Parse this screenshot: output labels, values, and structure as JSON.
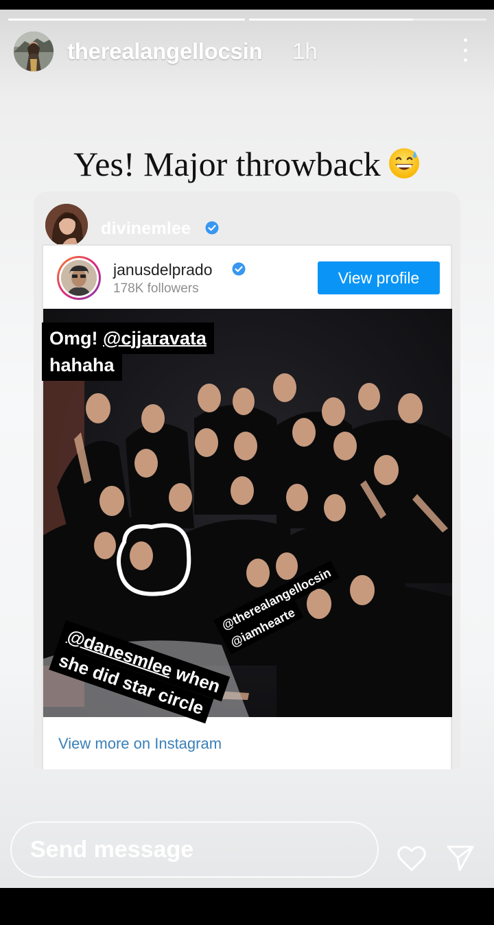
{
  "story": {
    "progress": [
      1.0,
      0.69
    ],
    "author": {
      "username": "therealangellocsin",
      "time": "1h",
      "avatar_icon": "profile-photo"
    },
    "more_icon": "more-vertical-icon",
    "caption": "Yes! Major throwback",
    "caption_emoji": "grinning-sweat-emoji"
  },
  "shared_post": {
    "sharer": {
      "username": "divinemlee",
      "verified": true
    },
    "embed": {
      "username": "janusdelprado",
      "verified": true,
      "followers": "178K followers",
      "view_profile_label": "View profile",
      "view_more_label": "View more on Instagram"
    },
    "stickers": {
      "top_line1_prefix": "Omg! ",
      "top_line1_mention": "@cjjaravata",
      "top_line2": "hahaha",
      "bottom_line1_mention": "@danesmlee",
      "bottom_line1_suffix": " when",
      "bottom_line2": "she did star circle",
      "tag1": "@therealangellocsin",
      "tag2": "@iamhearte"
    }
  },
  "reply_bar": {
    "placeholder": "Send message",
    "heart_icon": "heart-outline-icon",
    "send_icon": "paper-plane-icon"
  },
  "colors": {
    "button_blue": "#0a95f6",
    "link_blue": "#3a7fb7",
    "verified_blue": "#3897f0"
  }
}
